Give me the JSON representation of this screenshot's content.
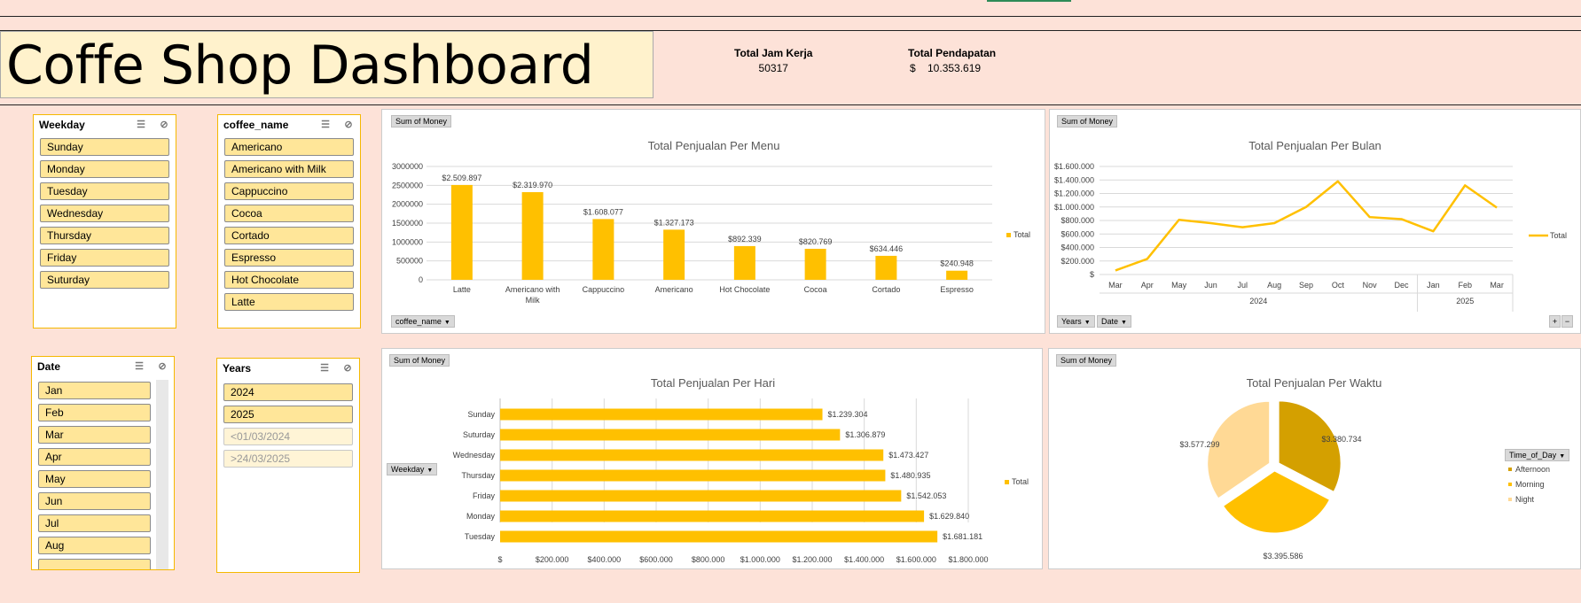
{
  "header": {
    "title": "Coffe Shop Dashboard",
    "kpi_hours_label": "Total Jam Kerja",
    "kpi_hours_value": "50317",
    "kpi_revenue_label": "Total Pendapatan",
    "kpi_revenue_value": "$    10.353.619"
  },
  "slicers": {
    "weekday": {
      "title": "Weekday",
      "items": [
        "Sunday",
        "Monday",
        "Tuesday",
        "Wednesday",
        "Thursday",
        "Friday",
        "Suturday"
      ]
    },
    "coffee": {
      "title": "coffee_name",
      "items": [
        "Americano",
        "Americano with Milk",
        "Cappuccino",
        "Cocoa",
        "Cortado",
        "Espresso",
        "Hot Chocolate",
        "Latte"
      ]
    },
    "date": {
      "title": "Date",
      "items": [
        "Jan",
        "Feb",
        "Mar",
        "Apr",
        "May",
        "Jun",
        "Jul",
        "Aug"
      ]
    },
    "years": {
      "title": "Years",
      "items": [
        "2024",
        "2025"
      ],
      "dim_items": [
        "<01/03/2024",
        ">24/03/2025"
      ]
    }
  },
  "buttons": {
    "sum_of_money": "Sum of Money",
    "coffee_name": "coffee_name",
    "years": "Years",
    "date": "Date",
    "weekday": "Weekday",
    "time_of_day": "Time_of_Day",
    "expand": "+",
    "collapse": "−"
  },
  "colors": {
    "accent": "#ffc000",
    "dark": "#d4a000",
    "light": "#ffd995",
    "background": "#fde2d8"
  },
  "chart_data": [
    {
      "type": "bar",
      "title": "Total Penjualan Per Menu",
      "categories": [
        "Latte",
        "Americano with Milk",
        "Cappuccino",
        "Americano",
        "Hot Chocolate",
        "Cocoa",
        "Cortado",
        "Espresso"
      ],
      "tick_lines": [
        [
          "Latte"
        ],
        [
          "Americano with",
          "Milk"
        ],
        [
          "Cappuccino"
        ],
        [
          "Americano"
        ],
        [
          "Hot Chocolate"
        ],
        [
          "Cocoa"
        ],
        [
          "Cortado"
        ],
        [
          "Espresso"
        ]
      ],
      "values": [
        2509897,
        2319970,
        1608077,
        1327173,
        892339,
        820769,
        634446,
        240948
      ],
      "labels": [
        "$2.509.897",
        "$2.319.970",
        "$1.608.077",
        "$1.327.173",
        "$892.339",
        "$820.769",
        "$634.446",
        "$240.948"
      ],
      "yticks": [
        "0",
        "500000",
        "1000000",
        "1500000",
        "2000000",
        "2500000",
        "3000000"
      ],
      "ylim": [
        0,
        3000000
      ],
      "legend": [
        "Total"
      ],
      "grid": true
    },
    {
      "type": "line",
      "title": "Total Penjualan Per Bulan",
      "x": [
        "Mar",
        "Apr",
        "May",
        "Jun",
        "Jul",
        "Aug",
        "Sep",
        "Oct",
        "Nov",
        "Dec",
        "Jan",
        "Feb",
        "Mar"
      ],
      "groups": [
        "2024",
        "2025"
      ],
      "values": [
        60000,
        230000,
        810000,
        760000,
        700000,
        760000,
        1000000,
        1380000,
        850000,
        820000,
        640000,
        1320000,
        990000
      ],
      "yticks": [
        "$",
        "$200.000",
        "$400.000",
        "$600.000",
        "$800.000",
        "$1.000.000",
        "$1.200.000",
        "$1.400.000",
        "$1.600.000"
      ],
      "ylim": [
        0,
        1600000
      ],
      "legend": [
        "Total"
      ],
      "grid": true
    },
    {
      "type": "bar",
      "orientation": "horizontal",
      "title": "Total Penjualan Per Hari",
      "categories": [
        "Sunday",
        "Suturday",
        "Wednesday",
        "Thursday",
        "Friday",
        "Monday",
        "Tuesday"
      ],
      "values": [
        1239304,
        1306879,
        1473427,
        1480935,
        1542053,
        1629840,
        1681181
      ],
      "labels": [
        "$1.239.304",
        "$1.306.879",
        "$1.473.427",
        "$1.480.935",
        "$1.542.053",
        "$1.629.840",
        "$1.681.181"
      ],
      "xticks": [
        "$",
        "$200.000",
        "$400.000",
        "$600.000",
        "$800.000",
        "$1.000.000",
        "$1.200.000",
        "$1.400.000",
        "$1.600.000",
        "$1.800.000"
      ],
      "xlim": [
        0,
        1800000
      ],
      "legend": [
        "Total"
      ],
      "grid": true
    },
    {
      "type": "pie",
      "title": "Total  Penjualan Per Waktu",
      "categories": [
        "Afternoon",
        "Morning",
        "Night"
      ],
      "values": [
        3380734,
        3395586,
        3577299
      ],
      "labels": [
        "$3.380.734",
        "$3.395.586",
        "$3.577.299"
      ],
      "colors": [
        "#d4a000",
        "#ffc000",
        "#ffd995"
      ],
      "legend_title": "Time_of_Day"
    }
  ]
}
